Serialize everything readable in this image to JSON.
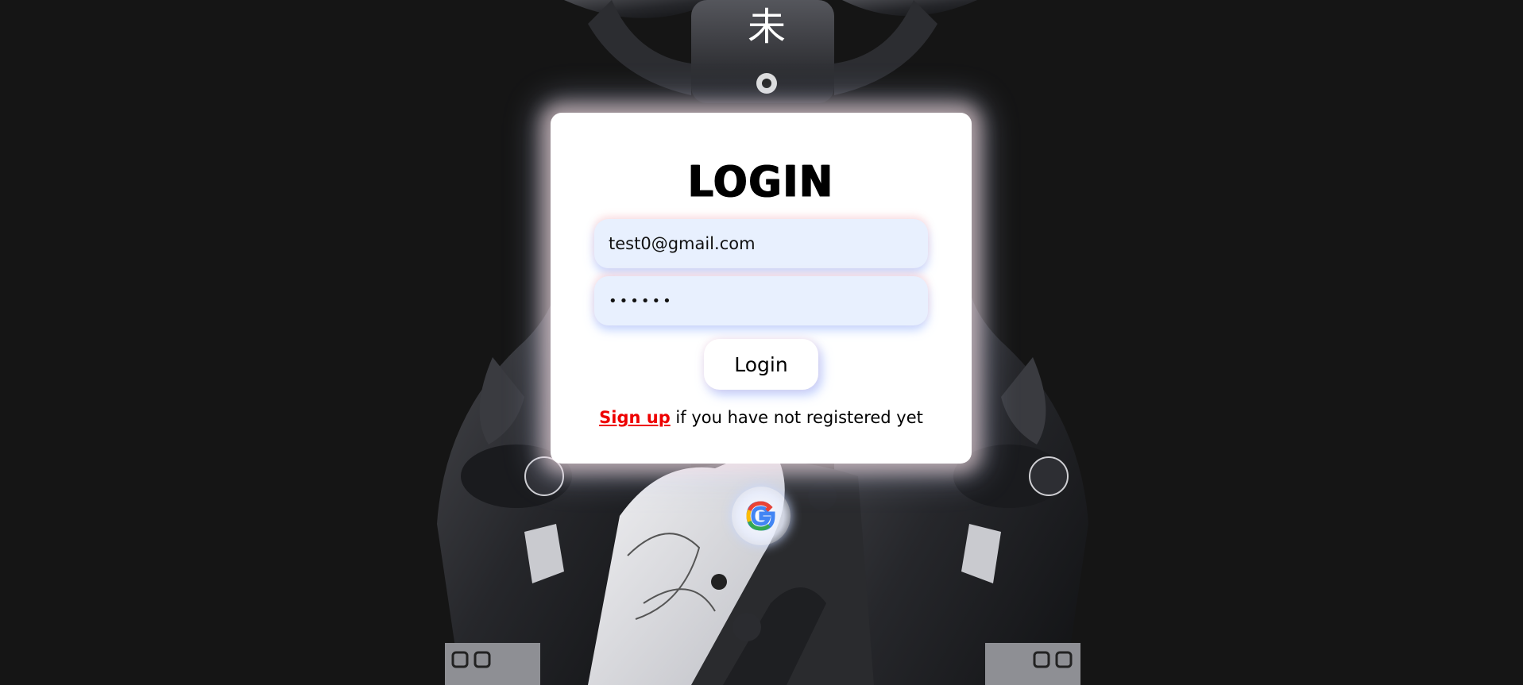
{
  "login": {
    "title": "LOGIN",
    "email_value": "test0@gmail.com",
    "password_value": "••••••",
    "button_label": "Login",
    "signup_link": "Sign up",
    "signup_text": " if you have not registered yet"
  },
  "icons": {
    "google": "google-icon",
    "background": "robot-illustration"
  },
  "colors": {
    "page_background": "#151515",
    "card_background": "#ffffff",
    "input_background": "#e8f0fe",
    "signup_link": "#ee0000"
  }
}
